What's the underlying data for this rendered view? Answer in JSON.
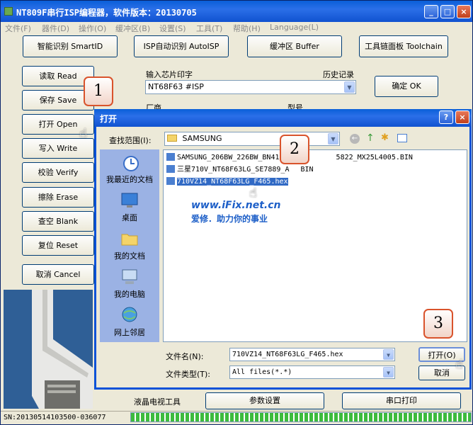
{
  "app": {
    "title": "NT809F串行ISP编程器，软件版本：20130705",
    "window_buttons": {
      "minimize": "_",
      "maximize": "□",
      "close": "×"
    }
  },
  "menu": [
    "文件(F)",
    "器件(D)",
    "操作(O)",
    "缓冲区(B)",
    "设置(S)",
    "工具(T)",
    "帮助(H)",
    "Language(L)"
  ],
  "top_buttons": [
    "智能识别 SmartID",
    "ISP自动识别 AutoISP",
    "缓冲区 Buffer",
    "工具链面板 Toolchain"
  ],
  "left_buttons": [
    "读取 Read",
    "保存 Save",
    "打开 Open",
    "写入 Write",
    "校验 Verify",
    "擦除 Erase",
    "查空 Blank",
    "复位 Reset",
    "取消 Cancel"
  ],
  "chip": {
    "input_label": "输入芯片印字",
    "history_label": "历史记录",
    "value": "NT68F63 #ISP",
    "confirm": "确定 OK",
    "vendor_label": "厂商",
    "model_label": "型号"
  },
  "bottom": {
    "lcd_tools": "液晶电视工具",
    "params": "参数设置",
    "serial": "串口打印",
    "serial_number": "SN:20130514103500-036077"
  },
  "dialog": {
    "title": "打开",
    "help": "?",
    "close": "×",
    "lookin_label": "查找范围(I):",
    "lookin_value": "SAMSUNG",
    "places": [
      "我最近的文档",
      "桌面",
      "我的文档",
      "我的电脑",
      "网上邻居"
    ],
    "files": [
      {
        "name": "SAMSUNG_206BW_226BW_BN41-0",
        "tail": "5822_MX25L4005.BIN",
        "selected": false
      },
      {
        "name": "三星710V_NT68F63LG_SE7889_A",
        "tail": "BIN",
        "selected": false
      },
      {
        "name": "710VZ14_NT68F63LG_F465.hex",
        "tail": "",
        "selected": true
      }
    ],
    "filename_label": "文件名(N):",
    "filename_value": "710VZ14_NT68F63LG_F465.hex",
    "filetype_label": "文件类型(T):",
    "filetype_value": "All files(*.*)",
    "open_button": "打开(O)",
    "cancel_button": "取消"
  },
  "watermark": {
    "line1": "www.iFix.net.cn",
    "line2": "爱修．助力你的事业"
  },
  "callouts": [
    "1",
    "2",
    "3"
  ],
  "colors": {
    "titlebar": "#1052d0",
    "selection": "#316ac5",
    "callout_border": "#d9532c"
  }
}
